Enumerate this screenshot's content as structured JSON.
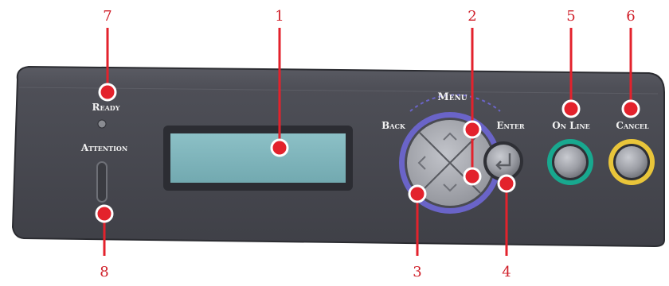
{
  "callouts": {
    "c1": "1",
    "c2": "2",
    "c3": "3",
    "c4": "4",
    "c5": "5",
    "c6": "6",
    "c7": "7",
    "c8": "8"
  },
  "labels": {
    "ready": "Ready",
    "attention": "Attention",
    "menu": "Menu",
    "back": "Back",
    "enter": "Enter",
    "online": "On Line",
    "cancel": "Cancel"
  },
  "colors": {
    "panel": "#4a4b52",
    "panel_dark": "#2f3036",
    "lcd": "#7fb4bb",
    "callout": "#e3222c",
    "nav_ring": "#6a64c8",
    "online_ring": "#18a88f",
    "cancel_ring": "#e9c53a"
  }
}
